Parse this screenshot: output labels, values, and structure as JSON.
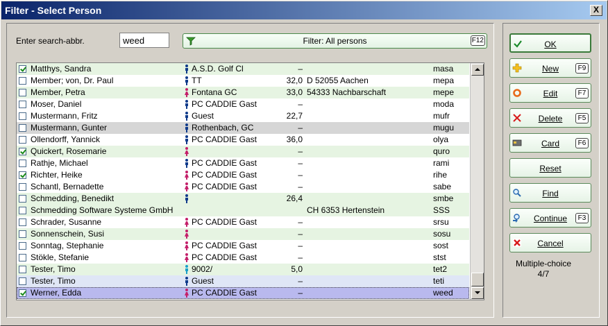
{
  "window": {
    "title": "Filter - Select Person",
    "close_label": "X"
  },
  "search": {
    "label": "Enter search-abbr.",
    "value": "weed"
  },
  "filter": {
    "label": "Filter: All persons",
    "shortcut": "F12"
  },
  "colors": {
    "male": "#0f3a8a",
    "female": "#c4206a",
    "guest_cyan": "#1aa0c8",
    "accent_green": "#3a7a3a"
  },
  "rows": [
    {
      "checked": true,
      "name": "Matthys, Sandra",
      "gender": "male",
      "club": "A.S.D. Golf Cl",
      "hcp": "–",
      "address": "",
      "abbr": "masa",
      "style": "zebra"
    },
    {
      "checked": false,
      "name": "Member; von, Dr. Paul",
      "gender": "male",
      "club": "TT",
      "hcp": "32,0",
      "address": "D 52055 Aachen",
      "abbr": "mepa",
      "style": ""
    },
    {
      "checked": false,
      "name": "Member, Petra",
      "gender": "female",
      "club": "Fontana GC",
      "hcp": "33,0",
      "address": "54333 Nachbarschaft",
      "abbr": "mepe",
      "style": "zebra"
    },
    {
      "checked": false,
      "name": "Moser, Daniel",
      "gender": "male",
      "club": "PC CADDIE Gast",
      "hcp": "–",
      "address": "",
      "abbr": "moda",
      "style": ""
    },
    {
      "checked": false,
      "name": "Mustermann, Fritz",
      "gender": "male",
      "club": "Guest",
      "hcp": "22,7",
      "address": "",
      "abbr": "mufr",
      "style": ""
    },
    {
      "checked": false,
      "name": "Mustermann, Gunter",
      "gender": "male",
      "club": "Rothenbach, GC",
      "hcp": "–",
      "address": "",
      "abbr": "mugu",
      "style": "gray"
    },
    {
      "checked": false,
      "name": "Ollendorff, Yannick",
      "gender": "male",
      "club": "PC CADDIE Gast",
      "hcp": "36,0",
      "address": "",
      "abbr": "olya",
      "style": ""
    },
    {
      "checked": true,
      "name": "Quickert, Rosemarie",
      "gender": "female",
      "club": "",
      "hcp": "–",
      "address": "",
      "abbr": "quro",
      "style": "zebra"
    },
    {
      "checked": false,
      "name": "Rathje, Michael",
      "gender": "male",
      "club": "PC CADDIE Gast",
      "hcp": "–",
      "address": "",
      "abbr": "rami",
      "style": ""
    },
    {
      "checked": true,
      "name": "Richter, Heike",
      "gender": "female",
      "club": "PC CADDIE Gast",
      "hcp": "–",
      "address": "",
      "abbr": "rihe",
      "style": ""
    },
    {
      "checked": false,
      "name": "Schantl, Bernadette",
      "gender": "female",
      "club": "PC CADDIE Gast",
      "hcp": "–",
      "address": "",
      "abbr": "sabe",
      "style": ""
    },
    {
      "checked": false,
      "name": "Schmedding, Benedikt",
      "gender": "male",
      "club": "",
      "hcp": "26,4",
      "address": "",
      "abbr": "smbe",
      "style": "zebra"
    },
    {
      "checked": false,
      "name": "Schmedding Software Systeme GmbH",
      "gender": "none",
      "club": "",
      "hcp": "",
      "address": "CH 6353 Hertenstein",
      "abbr": "SSS",
      "style": "zebra"
    },
    {
      "checked": false,
      "name": "Schrader, Susanne",
      "gender": "female",
      "club": "PC CADDIE Gast",
      "hcp": "–",
      "address": "",
      "abbr": "srsu",
      "style": ""
    },
    {
      "checked": false,
      "name": "Sonnenschein, Susi",
      "gender": "female",
      "club": "",
      "hcp": "–",
      "address": "",
      "abbr": "sosu",
      "style": "zebra"
    },
    {
      "checked": false,
      "name": "Sonntag, Stephanie",
      "gender": "female",
      "club": "PC CADDIE Gast",
      "hcp": "–",
      "address": "",
      "abbr": "sost",
      "style": ""
    },
    {
      "checked": false,
      "name": "Stökle, Stefanie",
      "gender": "female",
      "club": "PC CADDIE Gast",
      "hcp": "–",
      "address": "",
      "abbr": "stst",
      "style": ""
    },
    {
      "checked": false,
      "name": "Tester, Timo",
      "gender": "cyan",
      "club": "9002/",
      "hcp": "5,0",
      "address": "",
      "abbr": "tet2",
      "style": "zebra"
    },
    {
      "checked": false,
      "name": "Tester, Timo",
      "gender": "male",
      "club": "Guest",
      "hcp": "–",
      "address": "",
      "abbr": "teti",
      "style": "blue"
    },
    {
      "checked": true,
      "name": "Werner, Edda",
      "gender": "female",
      "club": "PC CADDIE Gast",
      "hcp": "–",
      "address": "",
      "abbr": "weed",
      "style": "sel"
    }
  ],
  "actions": [
    {
      "id": "ok",
      "label": "OK",
      "icon": "check-icon",
      "shortcut": ""
    },
    {
      "id": "new",
      "label": "New",
      "icon": "plus-icon",
      "shortcut": "F9"
    },
    {
      "id": "edit",
      "label": "Edit",
      "icon": "ring-icon",
      "shortcut": "F7"
    },
    {
      "id": "delete",
      "label": "Delete",
      "icon": "x-icon",
      "shortcut": "F5"
    },
    {
      "id": "card",
      "label": "Card",
      "icon": "card-icon",
      "shortcut": "F6"
    },
    {
      "id": "reset",
      "label": "Reset",
      "icon": "",
      "shortcut": ""
    },
    {
      "id": "find",
      "label": "Find",
      "icon": "magnifier-icon",
      "shortcut": ""
    },
    {
      "id": "continue",
      "label": "Continue",
      "icon": "magnifier-arrow-icon",
      "shortcut": "F3"
    },
    {
      "id": "cancel",
      "label": "Cancel",
      "icon": "cancel-icon",
      "shortcut": ""
    }
  ],
  "selection": {
    "label": "Multiple-choice",
    "count": "4/7"
  }
}
